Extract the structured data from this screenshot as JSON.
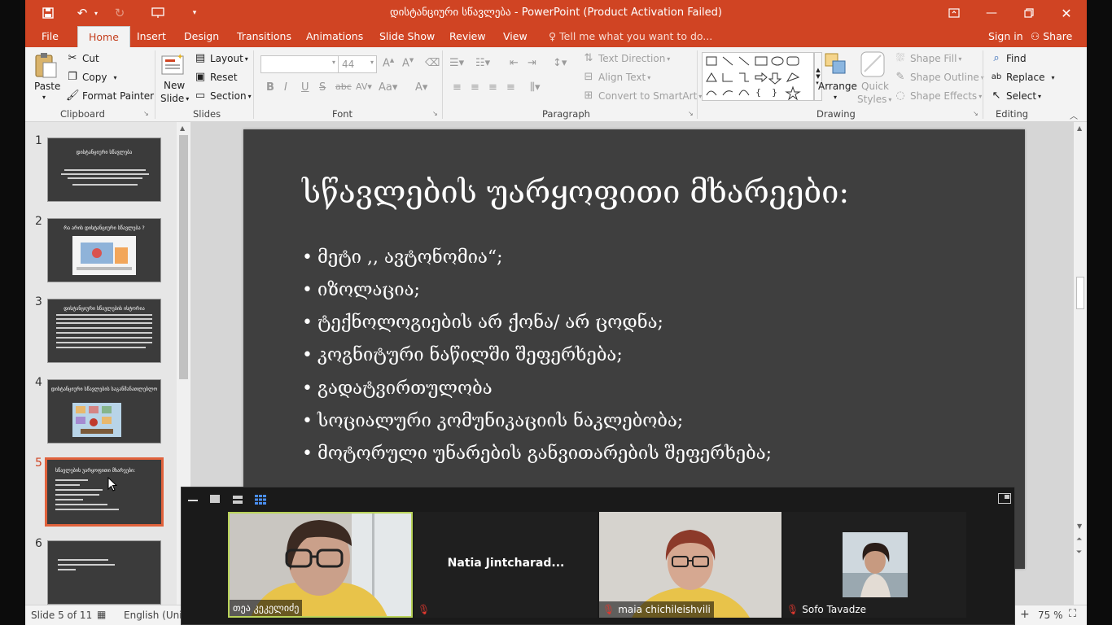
{
  "window": {
    "title": "დისტანციური სწავლება - PowerPoint (Product Activation Failed)"
  },
  "tabs": [
    "File",
    "Home",
    "Insert",
    "Design",
    "Transitions",
    "Animations",
    "Slide Show",
    "Review",
    "View"
  ],
  "tell_me": "Tell me what you want to do...",
  "account": {
    "signin": "Sign in",
    "share": "Share"
  },
  "ribbon": {
    "clipboard": {
      "paste": "Paste",
      "cut": "Cut",
      "copy": "Copy",
      "format_painter": "Format Painter",
      "label": "Clipboard"
    },
    "slides": {
      "new_slide_1": "New",
      "new_slide_2": "Slide",
      "layout": "Layout",
      "reset": "Reset",
      "section": "Section",
      "label": "Slides"
    },
    "font": {
      "size": "44",
      "label": "Font"
    },
    "paragraph": {
      "text_direction": "Text Direction",
      "align_text": "Align Text",
      "convert_smartart": "Convert to SmartArt",
      "label": "Paragraph"
    },
    "drawing": {
      "arrange": "Arrange",
      "quick_styles_1": "Quick",
      "quick_styles_2": "Styles",
      "shape_fill": "Shape Fill",
      "shape_outline": "Shape Outline",
      "shape_effects": "Shape Effects",
      "label": "Drawing"
    },
    "editing": {
      "find": "Find",
      "replace": "Replace",
      "select": "Select",
      "label": "Editing"
    }
  },
  "thumbnails": [
    {
      "num": "1",
      "title": "დისტანციური სწავლება"
    },
    {
      "num": "2",
      "title": "რა არის დისტანციური სწავლება ?"
    },
    {
      "num": "3",
      "title": "დისტანციური სწავლების ისტორია"
    },
    {
      "num": "4",
      "title": "დისტანციური სწავლების საგანმანათლებლო"
    },
    {
      "num": "5",
      "title": "სწავლების უარყოფითი მხარეები:"
    },
    {
      "num": "6",
      "title": ""
    }
  ],
  "slide": {
    "title": "სწავლების უარყოფითი მხარეები:",
    "bullets": [
      "მეტი ,, ავტონომია“;",
      "იზოლაცია;",
      "ტექნოლოგიების არ ქონა/ არ ცოდნა;",
      "კოგნიტური ნაწილში შეფერხება;",
      "გადატვირთულობა",
      "სოციალური კომუნიკაციის ნაკლებობა;",
      "მოტორული უნარების განვითარების შეფერხება;"
    ]
  },
  "status": {
    "slide_info": "Slide 5 of 11",
    "language": "English (Unite",
    "zoom": "75 %"
  },
  "meeting": {
    "participants": [
      {
        "name": "თეა კეკელიძე",
        "muted": false
      },
      {
        "name": "Natia  Jintcharad...",
        "muted": true
      },
      {
        "name": "maia chichileishvili",
        "muted": true
      },
      {
        "name": "Sofo Tavadze",
        "muted": true
      }
    ]
  },
  "colors": {
    "accent": "#d04423",
    "slide_bg": "#3f3f3f",
    "active_speaker": "#b9d35a"
  }
}
